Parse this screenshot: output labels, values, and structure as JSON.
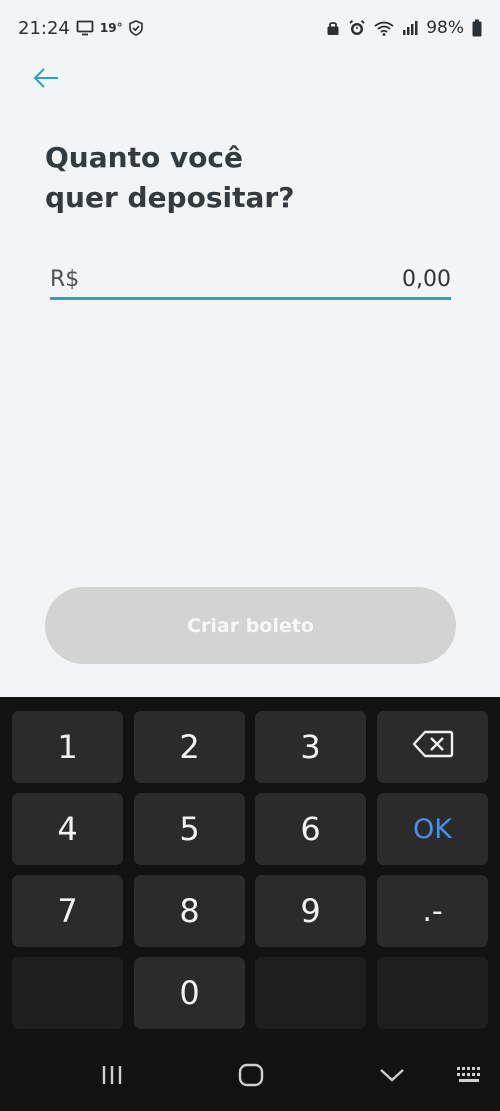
{
  "status_bar": {
    "time": "21:24",
    "temperature": "19°",
    "battery": "98%"
  },
  "header": {
    "back_icon": "arrow-left-icon",
    "title_line1": "Quanto você",
    "title_line2": "quer depositar?"
  },
  "amount": {
    "currency": "R$",
    "value": "0,00"
  },
  "cta": {
    "label": "Criar boleto"
  },
  "keyboard": {
    "keys": [
      "1",
      "2",
      "3",
      "4",
      "5",
      "6",
      "7",
      "8",
      "9",
      "0"
    ],
    "ok_label": "OK",
    "symbol_label": ".-"
  },
  "colors": {
    "accent": "#2f9fc6",
    "ok_key": "#4a8fea",
    "disabled_button": "#d3d3d3"
  }
}
